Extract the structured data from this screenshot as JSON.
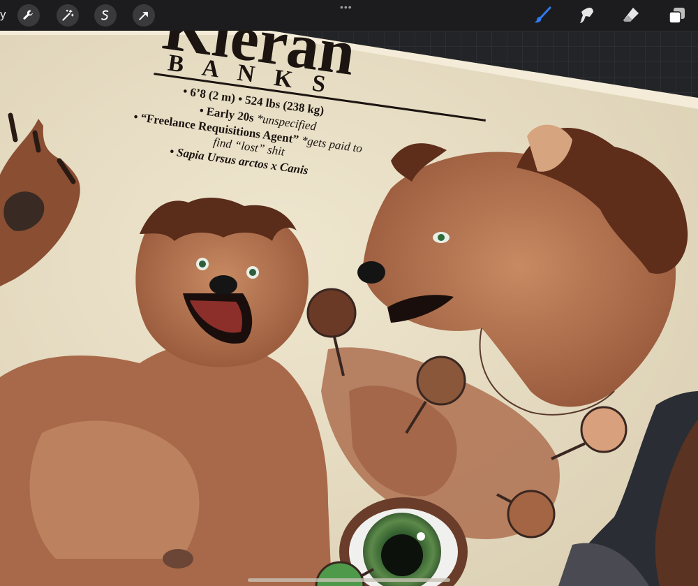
{
  "toolbar": {
    "gallery_label": "y",
    "left_tools": [
      {
        "name": "wrench-icon"
      },
      {
        "name": "magic-wand-icon"
      },
      {
        "name": "selection-icon"
      },
      {
        "name": "transform-arrow-icon"
      }
    ],
    "more_label": "•••",
    "right_tools": [
      {
        "name": "brush-icon",
        "active": true
      },
      {
        "name": "smudge-icon"
      },
      {
        "name": "eraser-icon"
      },
      {
        "name": "layers-icon"
      }
    ],
    "accent_color": "#2f7bf0"
  },
  "character_sheet": {
    "first_name": "Kieran",
    "last_name": "B A N K S",
    "stats": [
      "• 6’8 (2 m) • 524 lbs (238 kg)",
      "• Early 20s ",
      "• “Freelance Requisitions Agent” ",
      "• Sapia Ursus arctos x Canis"
    ],
    "age_note": "*unspecified",
    "job_note_line1": "*gets paid to",
    "job_note_line2": "find “lost” shit"
  },
  "palette": {
    "swatch_1": "#6b3a26",
    "swatch_2": "#8a573b",
    "swatch_3": "#d8a07c",
    "swatch_4": "#a36543",
    "swatch_5": "#4e9a4a"
  }
}
